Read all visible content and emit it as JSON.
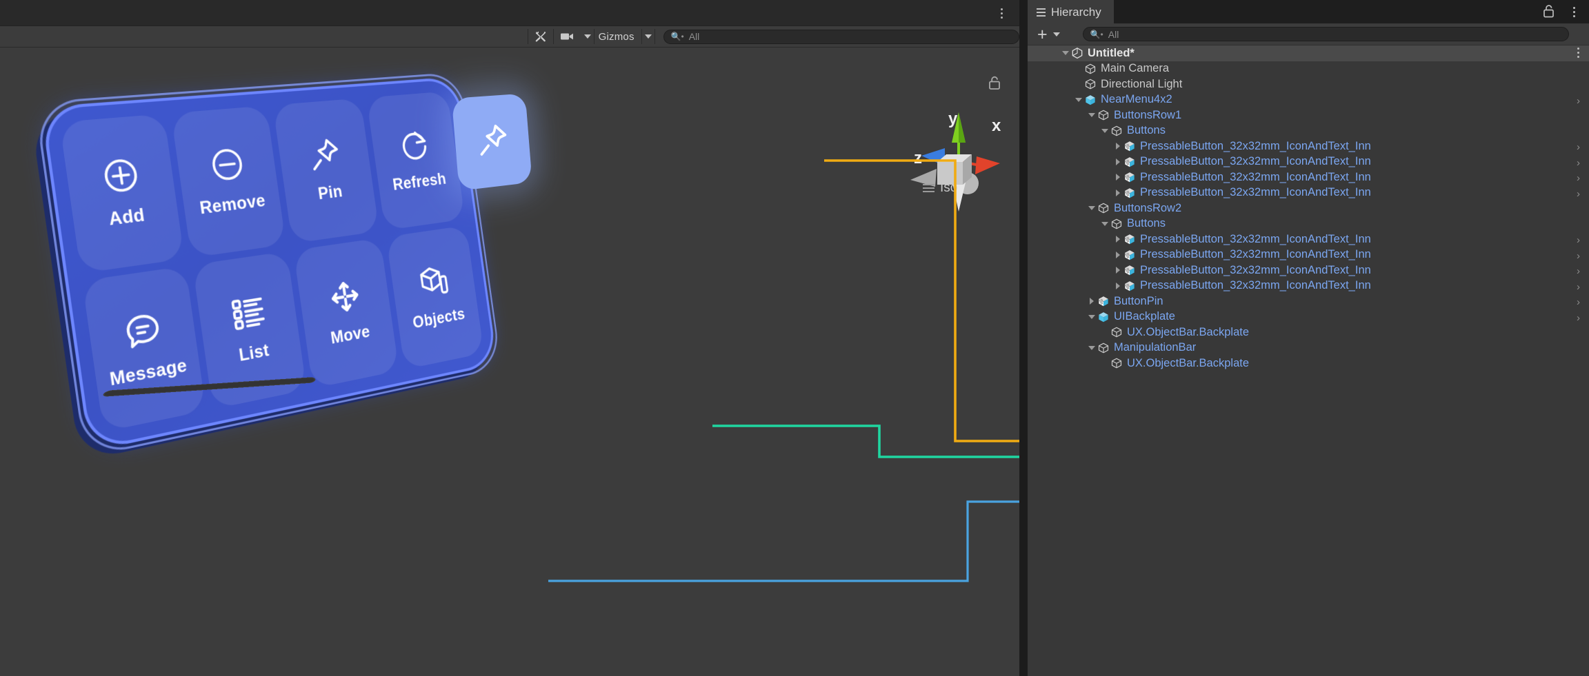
{
  "scene_panel": {
    "toolbar": {
      "tools_icon": "tools-icon",
      "camera_icon": "camera-icon",
      "camera_dropdown_icon": "chevron-down-icon",
      "gizmos_label": "Gizmos",
      "gizmos_dropdown_icon": "chevron-down-icon",
      "search_icon": "search-icon",
      "search_placeholder": "All",
      "search_value": ""
    },
    "overflow_icon": "kebab-menu-icon",
    "gizmo": {
      "axis_x": "x",
      "axis_y": "y",
      "axis_z": "z",
      "projection_label": "Iso",
      "projection_icon": "hamburger-icon",
      "lock_icon": "unlock-icon",
      "colors": {
        "x": "#e2432b",
        "y": "#7fd020",
        "z": "#3a7de0",
        "cube": "#c8c8c8"
      }
    },
    "near_menu": {
      "name": "NearMenu4x2",
      "row1": [
        {
          "label": "Add",
          "icon": "plus-circle-icon"
        },
        {
          "label": "Remove",
          "icon": "minus-circle-icon"
        },
        {
          "label": "Pin",
          "icon": "pin-icon"
        },
        {
          "label": "Refresh",
          "icon": "refresh-icon"
        }
      ],
      "row2": [
        {
          "label": "Message",
          "icon": "message-icon"
        },
        {
          "label": "List",
          "icon": "list-icon"
        },
        {
          "label": "Move",
          "icon": "move-icon"
        },
        {
          "label": "Objects",
          "icon": "objects-icon"
        }
      ],
      "colors": {
        "slab": "#3f58cf",
        "border": "#6d86ff",
        "button": "rgba(255,255,255,0.085)"
      }
    },
    "floating_pin_button": {
      "icon": "pin-icon",
      "color": "#8fabf5"
    },
    "connectors": [
      {
        "name": "button-pin-connector",
        "color": "#f0ab13"
      },
      {
        "name": "ui-backplate-connector",
        "color": "#1fd6a0"
      },
      {
        "name": "manipulation-bar-connector",
        "color": "#4aa3e0"
      }
    ]
  },
  "hierarchy": {
    "tab_label": "Hierarchy",
    "tab_icon": "hierarchy-icon",
    "lock_icon": "unlock-icon",
    "overflow_icon": "kebab-menu-icon",
    "create_label": "+",
    "create_dropdown_icon": "chevron-down-icon",
    "search_icon": "search-icon",
    "search_placeholder": "All",
    "search_value": "",
    "rows": [
      {
        "label": "Untitled*",
        "indent": 0,
        "twisty": "down",
        "icon": "unity-scene-icon",
        "style": "white",
        "selected": true,
        "chevron": false,
        "kebab": true
      },
      {
        "label": "Main Camera",
        "indent": 1,
        "twisty": "none",
        "icon": "gameobject-icon",
        "style": "plain",
        "selected": false,
        "chevron": false,
        "kebab": false
      },
      {
        "label": "Directional Light",
        "indent": 1,
        "twisty": "none",
        "icon": "gameobject-icon",
        "style": "plain",
        "selected": false,
        "chevron": false,
        "kebab": false
      },
      {
        "label": "NearMenu4x2",
        "indent": 1,
        "twisty": "down",
        "icon": "prefab-icon",
        "style": "prefab",
        "selected": false,
        "chevron": true,
        "kebab": false
      },
      {
        "label": "ButtonsRow1",
        "indent": 2,
        "twisty": "down",
        "icon": "gameobject-icon",
        "style": "prefab",
        "selected": false,
        "chevron": false,
        "kebab": false
      },
      {
        "label": "Buttons",
        "indent": 3,
        "twisty": "down",
        "icon": "gameobject-icon",
        "style": "prefab",
        "selected": false,
        "chevron": false,
        "kebab": false
      },
      {
        "label": "PressableButton_32x32mm_IconAndText_Inn",
        "indent": 4,
        "twisty": "right",
        "icon": "prefabvariant-icon",
        "style": "prefab",
        "selected": false,
        "chevron": true,
        "kebab": false
      },
      {
        "label": "PressableButton_32x32mm_IconAndText_Inn",
        "indent": 4,
        "twisty": "right",
        "icon": "prefabvariant-icon",
        "style": "prefab",
        "selected": false,
        "chevron": true,
        "kebab": false
      },
      {
        "label": "PressableButton_32x32mm_IconAndText_Inn",
        "indent": 4,
        "twisty": "right",
        "icon": "prefabvariant-icon",
        "style": "prefab",
        "selected": false,
        "chevron": true,
        "kebab": false
      },
      {
        "label": "PressableButton_32x32mm_IconAndText_Inn",
        "indent": 4,
        "twisty": "right",
        "icon": "prefabvariant-icon",
        "style": "prefab",
        "selected": false,
        "chevron": true,
        "kebab": false
      },
      {
        "label": "ButtonsRow2",
        "indent": 2,
        "twisty": "down",
        "icon": "gameobject-icon",
        "style": "prefab",
        "selected": false,
        "chevron": false,
        "kebab": false
      },
      {
        "label": "Buttons",
        "indent": 3,
        "twisty": "down",
        "icon": "gameobject-icon",
        "style": "prefab",
        "selected": false,
        "chevron": false,
        "kebab": false
      },
      {
        "label": "PressableButton_32x32mm_IconAndText_Inn",
        "indent": 4,
        "twisty": "right",
        "icon": "prefabvariant-icon",
        "style": "prefab",
        "selected": false,
        "chevron": true,
        "kebab": false
      },
      {
        "label": "PressableButton_32x32mm_IconAndText_Inn",
        "indent": 4,
        "twisty": "right",
        "icon": "prefabvariant-icon",
        "style": "prefab",
        "selected": false,
        "chevron": true,
        "kebab": false
      },
      {
        "label": "PressableButton_32x32mm_IconAndText_Inn",
        "indent": 4,
        "twisty": "right",
        "icon": "prefabvariant-icon",
        "style": "prefab",
        "selected": false,
        "chevron": true,
        "kebab": false
      },
      {
        "label": "PressableButton_32x32mm_IconAndText_Inn",
        "indent": 4,
        "twisty": "right",
        "icon": "prefabvariant-icon",
        "style": "prefab",
        "selected": false,
        "chevron": true,
        "kebab": false
      },
      {
        "label": "ButtonPin",
        "indent": 2,
        "twisty": "right",
        "icon": "prefabvariant-icon",
        "style": "prefab",
        "selected": false,
        "chevron": true,
        "kebab": false
      },
      {
        "label": "UIBackplate",
        "indent": 2,
        "twisty": "down",
        "icon": "prefab-icon",
        "style": "prefab",
        "selected": false,
        "chevron": true,
        "kebab": false
      },
      {
        "label": "UX.ObjectBar.Backplate",
        "indent": 3,
        "twisty": "none",
        "icon": "gameobject-icon",
        "style": "prefab",
        "selected": false,
        "chevron": false,
        "kebab": false
      },
      {
        "label": "ManipulationBar",
        "indent": 2,
        "twisty": "down",
        "icon": "gameobject-icon",
        "style": "prefab",
        "selected": false,
        "chevron": false,
        "kebab": false
      },
      {
        "label": "UX.ObjectBar.Backplate",
        "indent": 3,
        "twisty": "none",
        "icon": "gameobject-icon",
        "style": "prefab",
        "selected": false,
        "chevron": false,
        "kebab": false
      }
    ]
  }
}
